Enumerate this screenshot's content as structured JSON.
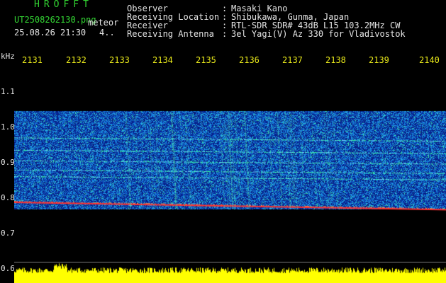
{
  "header": {
    "app_title": "HROFFT",
    "file_name": "UT2508262130.png",
    "category": "meteor",
    "datetime": "25.08.26 21:30",
    "count": "4..",
    "info": [
      {
        "label": "Observer",
        "value": "Masaki Kano"
      },
      {
        "label": "Receiving Location",
        "value": "Shibukawa, Gunma, Japan"
      },
      {
        "label": "Receiver",
        "value": "RTL-SDR SDR# 43dB L15 103.2MHz CW"
      },
      {
        "label": "Receiving Antenna",
        "value": "3el Yagi(V) Az 330 for Vladivostok"
      }
    ],
    "separator": ":"
  },
  "axes": {
    "y_unit": "kHz",
    "y_ticks": [
      "1.1",
      "1.0",
      "0.9",
      "0.8",
      "0.7",
      "0.6"
    ],
    "x_ticks": [
      "2131",
      "2132",
      "2133",
      "2134",
      "2135",
      "2136",
      "2137",
      "2138",
      "2139",
      "2140"
    ]
  },
  "spectrogram": {
    "freq_range_khz": [
      0.58,
      1.14
    ],
    "signal_band_khz": [
      0.78,
      1.04
    ],
    "persistent_lines_khz": [
      0.971,
      0.938,
      0.91,
      0.885,
      0.868,
      0.8
    ],
    "colors": {
      "background": "#000000",
      "noise_low": "#0a1fa0",
      "noise_mid": "#2060ff",
      "signal": "#34ffa0",
      "carrier": "#ff3030",
      "level": "#ffff00"
    }
  }
}
